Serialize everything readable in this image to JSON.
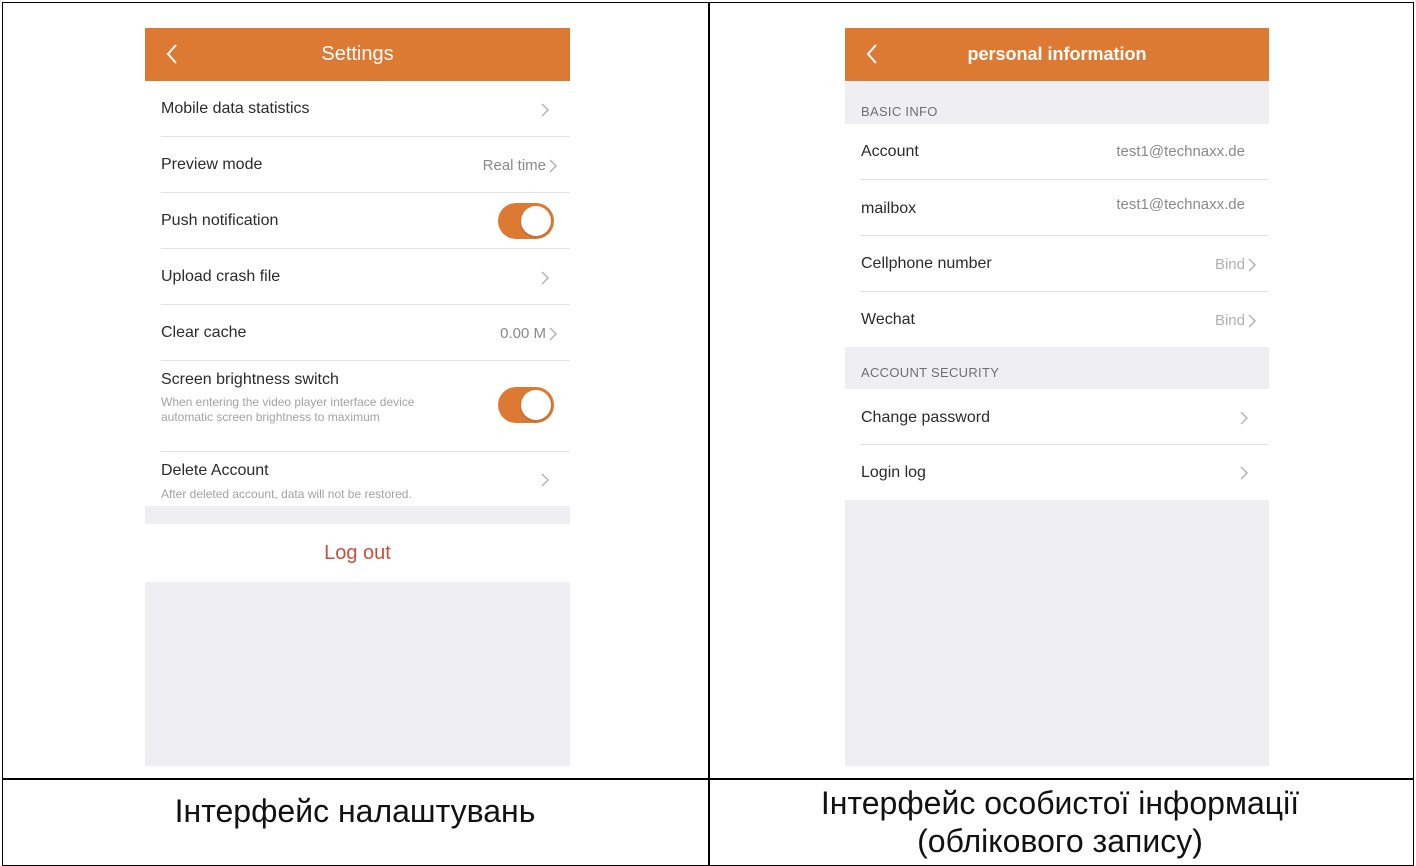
{
  "settings": {
    "title": "Settings",
    "rows": [
      {
        "label": "Mobile data statistics",
        "value": ""
      },
      {
        "label": "Preview mode",
        "value": "Real time"
      },
      {
        "label": "Push notification",
        "toggle": true
      },
      {
        "label": "Upload crash file",
        "value": ""
      },
      {
        "label": "Clear cache",
        "value": "0.00 M"
      },
      {
        "label": "Screen brightness switch",
        "sub": "When entering the video player interface device automatic screen brightness to maximum",
        "toggle": true
      },
      {
        "label": "Delete Account",
        "sub": "After deleted account, data will not be restored."
      }
    ],
    "logout": "Log out"
  },
  "personal": {
    "title": "personal information",
    "basic_header": "BASIC INFO",
    "basic_rows": [
      {
        "label": "Account",
        "value": "test1@technaxx.de"
      },
      {
        "label": "mailbox",
        "value": "test1@technaxx.de"
      },
      {
        "label": "Cellphone number",
        "value": "Bind"
      },
      {
        "label": "Wechat",
        "value": "Bind"
      }
    ],
    "security_header": "ACCOUNT SECURITY",
    "security_rows": [
      {
        "label": "Change password"
      },
      {
        "label": "Login log"
      }
    ]
  },
  "captions": {
    "left": "Інтерфейс налаштувань",
    "right": "Інтерфейс особистої інформації (облікового запису)"
  },
  "colors": {
    "accent": "#dc7a33",
    "logout": "#c8503a",
    "background": "#efeff3"
  }
}
